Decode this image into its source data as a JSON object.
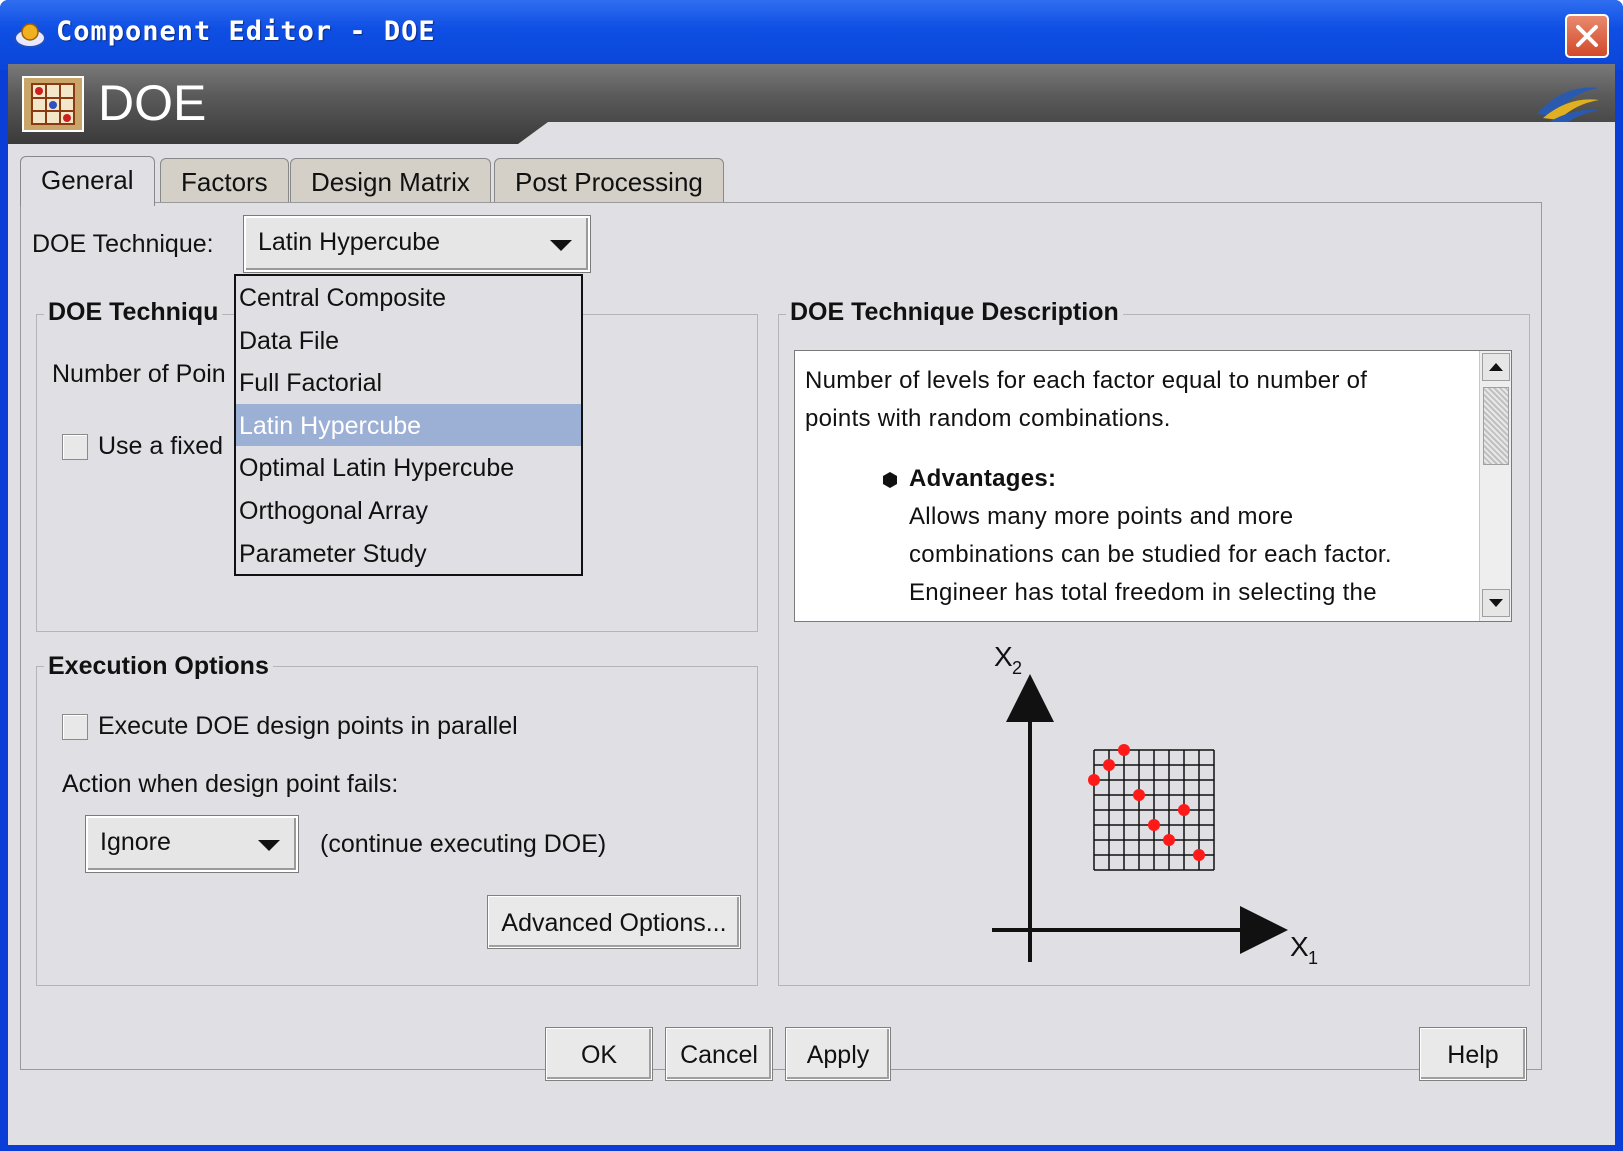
{
  "window": {
    "title": "Component Editor - DOE",
    "icons": {
      "app": "app-icon",
      "close": "close-icon"
    },
    "accent_color": "#0a3ed6"
  },
  "header": {
    "title": "DOE",
    "icon": "doe-grid-icon",
    "brand_icon": "brand-logo-icon"
  },
  "tabs": [
    "General",
    "Factors",
    "Design Matrix",
    "Post Processing"
  ],
  "active_tab": "General",
  "general": {
    "technique_label": "DOE Technique:",
    "technique_value": "Latin Hypercube",
    "technique_options": [
      "Central Composite",
      "Data File",
      "Full Factorial",
      "Latin Hypercube",
      "Optimal Latin Hypercube",
      "Orthogonal Array",
      "Parameter Study"
    ],
    "selected_option": "Latin Hypercube",
    "selected_color": "#9cb0d6",
    "options_group_title": "DOE Techniqu",
    "num_points_label": "Number of Poin",
    "fixed_checkbox_label": "Use a fixed",
    "fixed_checked": false
  },
  "execution": {
    "title": "Execution Options",
    "parallel_label": "Execute DOE design points in parallel",
    "parallel_checked": false,
    "fail_action_label": "Action when design point fails:",
    "fail_action_value": "Ignore",
    "fail_action_note": "(continue executing DOE)",
    "advanced_button": "Advanced Options..."
  },
  "description": {
    "title": "DOE Technique Description",
    "lines": [
      "Number of levels for each factor equal to number of",
      "points with random combinations."
    ],
    "advantages_heading": "Advantages:",
    "advantages_lines": [
      "Allows many more points and more",
      "combinations can be studied for each factor.",
      "Engineer has total freedom in selecting the"
    ],
    "diagram": {
      "x_axis_label": "X",
      "x_axis_sub": "1",
      "y_axis_label": "X",
      "y_axis_sub": "2",
      "point_color": "#ff1a1a",
      "grid_cells": 8,
      "points": [
        [
          0,
          2
        ],
        [
          1,
          1
        ],
        [
          2,
          0
        ],
        [
          3,
          3
        ],
        [
          4,
          5
        ],
        [
          5,
          6
        ],
        [
          6,
          4
        ],
        [
          7,
          7
        ]
      ]
    }
  },
  "footer": {
    "ok": "OK",
    "cancel": "Cancel",
    "apply": "Apply",
    "help": "Help"
  }
}
